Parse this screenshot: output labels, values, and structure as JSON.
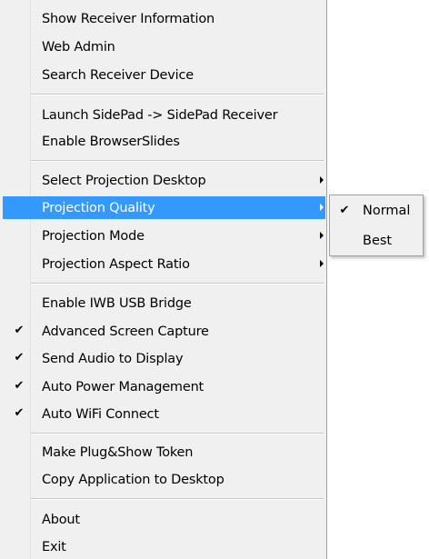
{
  "menu": {
    "items": [
      {
        "label": "Show Receiver Information"
      },
      {
        "label": "Web Admin"
      },
      {
        "label": "Search Receiver Device"
      },
      {
        "label": "Launch SidePad -> SidePad Receiver"
      },
      {
        "label": "Enable BrowserSlides"
      },
      {
        "label": "Select Projection Desktop",
        "has_submenu": true
      },
      {
        "label": "Projection Quality",
        "has_submenu": true,
        "highlighted": true
      },
      {
        "label": "Projection Mode",
        "has_submenu": true
      },
      {
        "label": "Projection Aspect Ratio",
        "has_submenu": true
      },
      {
        "label": "Enable IWB USB Bridge"
      },
      {
        "label": "Advanced Screen Capture",
        "checked": true
      },
      {
        "label": "Send Audio to Display",
        "checked": true
      },
      {
        "label": "Auto Power Management",
        "checked": true
      },
      {
        "label": "Auto WiFi Connect",
        "checked": true
      },
      {
        "label": "Make Plug&Show Token"
      },
      {
        "label": "Copy Application to Desktop"
      },
      {
        "label": "About"
      },
      {
        "label": "Exit"
      }
    ]
  },
  "submenu": {
    "items": [
      {
        "label": "Normal",
        "checked": true
      },
      {
        "label": "Best"
      }
    ]
  },
  "icons": {
    "check": "check-icon",
    "submenu_arrow": "submenu-arrow-icon"
  },
  "colors": {
    "menu_bg": "#f0f0f0",
    "highlight_bg": "#3399ff",
    "highlight_text": "#ffffff"
  },
  "glyphs": {
    "check": "✔"
  }
}
